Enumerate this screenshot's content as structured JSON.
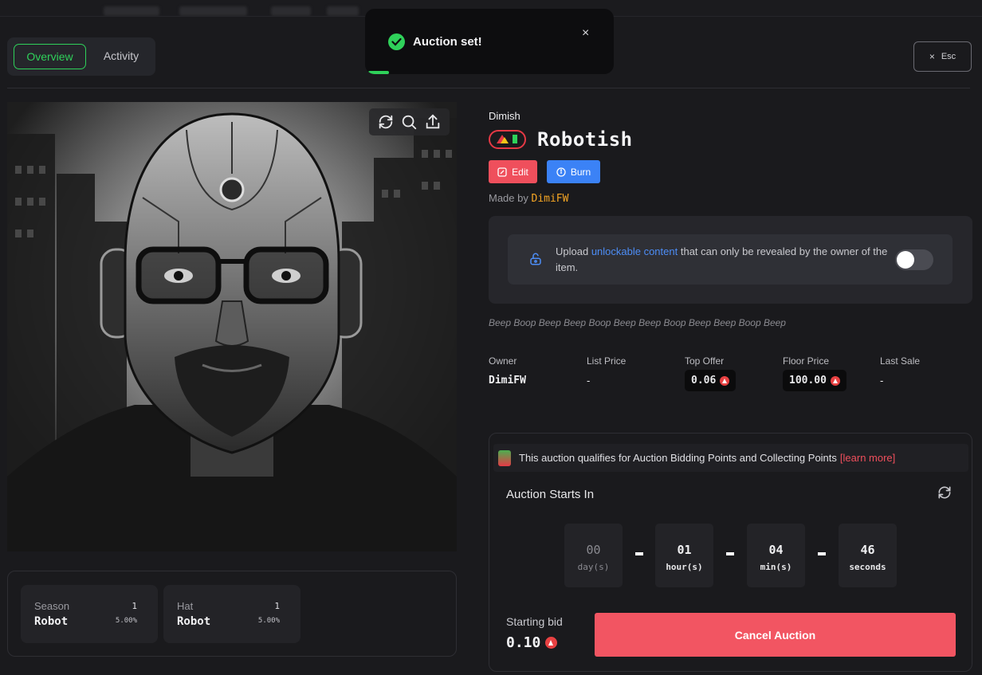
{
  "toast": {
    "message": "Auction set!",
    "close": "×"
  },
  "tabs": [
    {
      "label": "Overview"
    },
    {
      "label": "Activity"
    }
  ],
  "esc": {
    "label": "Esc",
    "icon": "×"
  },
  "item": {
    "collection": "Dimish",
    "title": "Robotish",
    "edit_label": "Edit",
    "burn_label": "Burn",
    "made_by_prefix": "Made by",
    "creator": "DimiFW",
    "description": "Beep Boop Beep Beep Boop Beep Beep Boop Beep Beep Boop Beep"
  },
  "unlockable": {
    "pre": "Upload ",
    "link": "unlockable content",
    "post": " that can only be revealed by the owner of the item.",
    "enabled": false
  },
  "stats": {
    "owner": {
      "label": "Owner",
      "value": "DimiFW"
    },
    "list_price": {
      "label": "List Price",
      "value": "-"
    },
    "top_offer": {
      "label": "Top Offer",
      "value": "0.06"
    },
    "floor_price": {
      "label": "Floor Price",
      "value": "100.00"
    },
    "last_sale": {
      "label": "Last Sale",
      "value": "-"
    }
  },
  "traits": [
    {
      "name": "Season",
      "value": "Robot",
      "count": "1",
      "percent": "5.00%"
    },
    {
      "name": "Hat",
      "value": "Robot",
      "count": "1",
      "percent": "5.00%"
    }
  ],
  "auction": {
    "banner_text": "This auction qualifies for Auction Bidding Points and Collecting Points",
    "learn_more": "[learn more]",
    "starts_label": "Auction Starts In",
    "countdown": [
      {
        "value": "00",
        "unit": "day(s)"
      },
      {
        "value": "01",
        "unit": "hour(s)"
      },
      {
        "value": "04",
        "unit": "min(s)"
      },
      {
        "value": "46",
        "unit": "seconds"
      }
    ],
    "starting_bid_label": "Starting bid",
    "starting_bid": "0.10",
    "cancel_label": "Cancel Auction"
  },
  "colors": {
    "accent_green": "#2fd15a",
    "danger": "#ef4f5c",
    "info": "#3b82f6",
    "creator": "#f5a524"
  }
}
